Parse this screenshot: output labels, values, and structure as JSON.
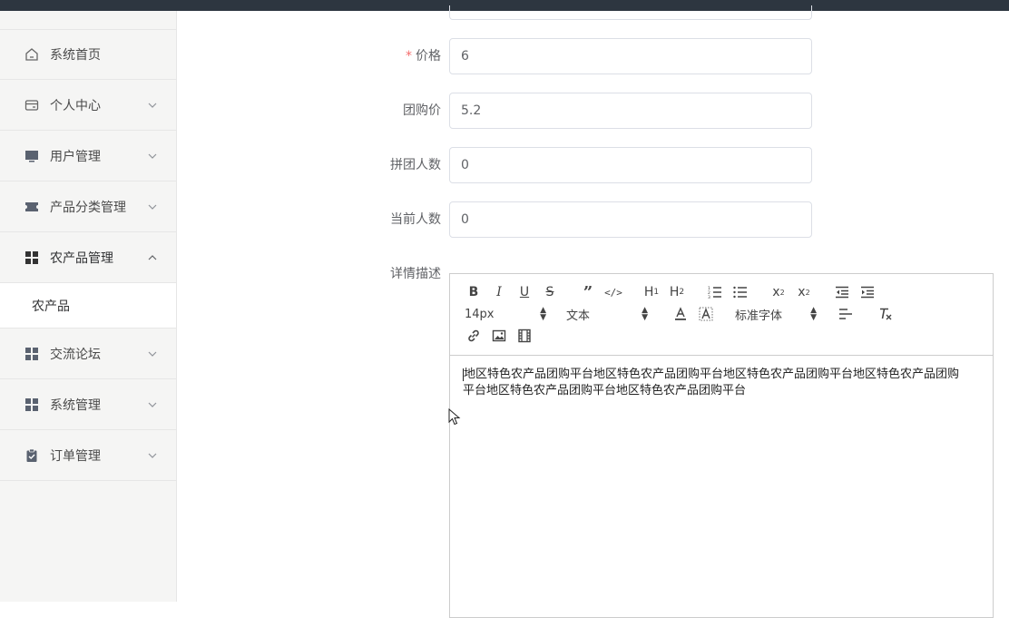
{
  "sidebar": {
    "items": [
      {
        "label": "系统首页",
        "icon": "home-icon",
        "expanded": null
      },
      {
        "label": "个人中心",
        "icon": "card-icon",
        "expanded": false
      },
      {
        "label": "用户管理",
        "icon": "monitor-icon",
        "expanded": false
      },
      {
        "label": "产品分类管理",
        "icon": "ticket-icon",
        "expanded": false
      },
      {
        "label": "农产品管理",
        "icon": "grid-icon",
        "expanded": true
      },
      {
        "label": "交流论坛",
        "icon": "grid-icon",
        "expanded": false
      },
      {
        "label": "系统管理",
        "icon": "grid-icon",
        "expanded": false
      },
      {
        "label": "订单管理",
        "icon": "clipboard-icon",
        "expanded": false
      }
    ],
    "subitems": {
      "nongchanpin": "农产品"
    }
  },
  "form": {
    "price": {
      "label": "价格",
      "required_mark": "*",
      "value": "6"
    },
    "group_price": {
      "label": "团购价",
      "value": "5.2"
    },
    "group_size": {
      "label": "拼团人数",
      "value": "0"
    },
    "current_count": {
      "label": "当前人数",
      "value": "0"
    },
    "description": {
      "label": "详情描述",
      "font_size_option": "14px",
      "text_type_option": "文本",
      "font_family_option": "标准字体",
      "content": "地区特色农产品团购平台地区特色农产品团购平台地区特色农产品团购平台地区特色农产品团购平台地区特色农产品团购平台地区特色农产品团购平台"
    }
  },
  "colors": {
    "topbar": "#2d3640",
    "required": "#f56c6c",
    "sidebar_bg": "#f5f5f4"
  }
}
